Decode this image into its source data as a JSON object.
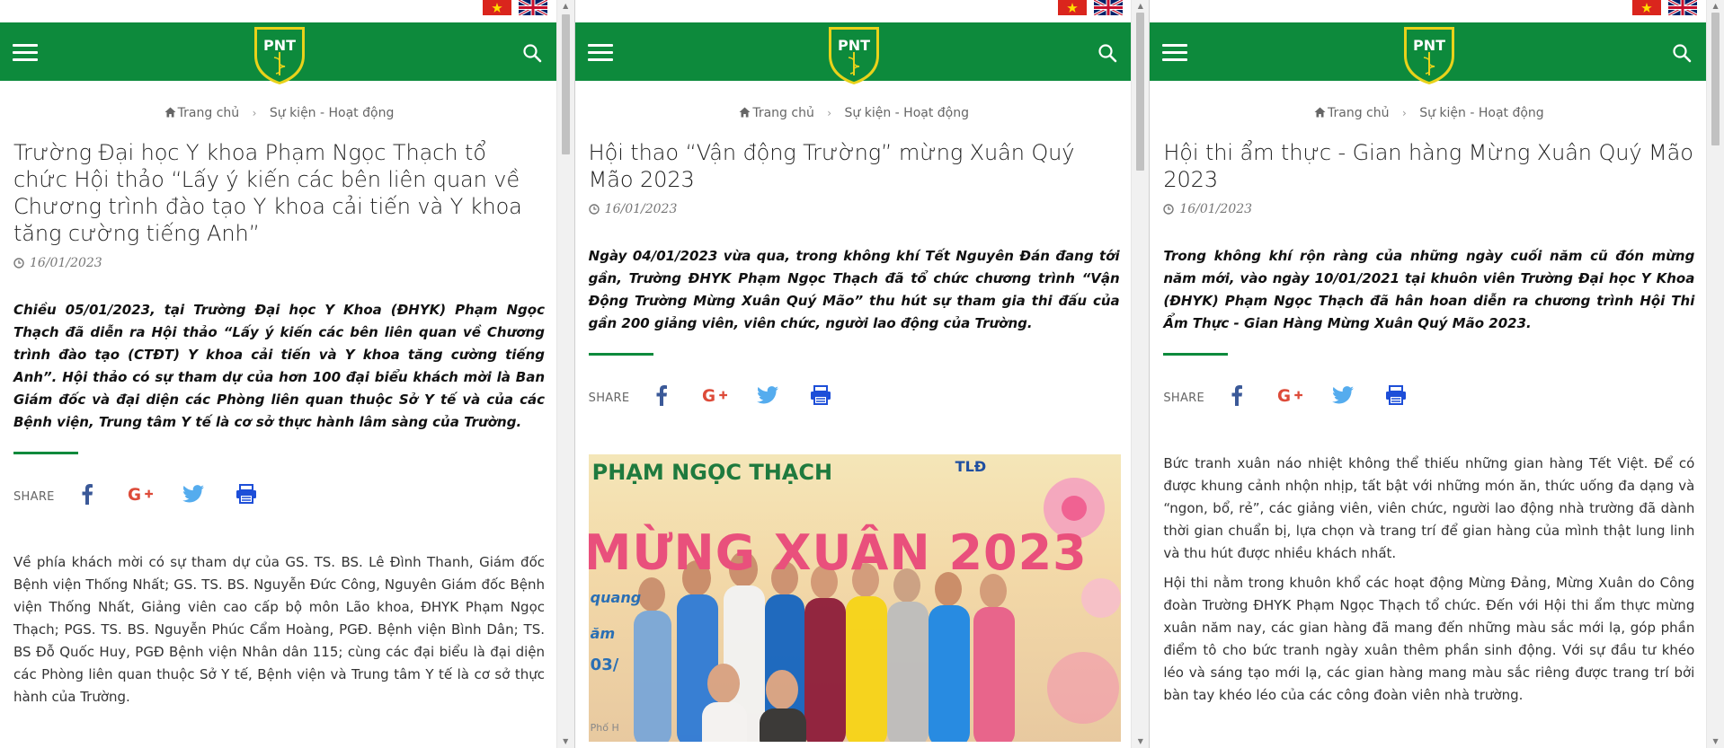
{
  "colors": {
    "brand_green": "#0d8a3c",
    "facebook": "#3b5998",
    "google_plus": "#dd4b39",
    "twitter": "#55acee",
    "print": "#1d4ed8"
  },
  "common": {
    "logo_text": "PNT",
    "breadcrumb_home": "Trang chủ",
    "breadcrumb_section": "Sự kiện - Hoạt động",
    "share_label": "SHARE",
    "icons": [
      "menu-icon",
      "search-icon",
      "vietnam-flag-icon",
      "uk-flag-icon",
      "home-icon",
      "clock-icon",
      "facebook-icon",
      "google-plus-icon",
      "twitter-icon",
      "print-icon"
    ]
  },
  "panes": [
    {
      "title": "Trường Đại học Y khoa Phạm Ngọc Thạch tổ chức Hội thảo “Lấy ý kiến các bên liên quan về Chương trình đào tạo Y khoa cải tiến và Y khoa tăng cường tiếng Anh”",
      "date": "16/01/2023",
      "lead": "Chiều 05/01/2023, tại Trường Đại học Y Khoa (ĐHYK) Phạm Ngọc Thạch đã diễn ra Hội thảo “Lấy ý kiến các bên liên quan về Chương trình đào tạo (CTĐT) Y khoa cải tiến và Y khoa tăng cường tiếng Anh”. Hội thảo có sự tham dự của hơn 100 đại biểu khách mời là Ban Giám đốc và đại diện các Phòng liên quan thuộc Sở Y tế và của các Bệnh viện, Trung tâm Y tế là cơ sở thực hành lâm sàng của Trường.",
      "body": [
        "Về phía khách mời có sự tham dự của GS. TS. BS. Lê Đình Thanh, Giám đốc Bệnh viện Thống Nhất; GS. TS. BS. Nguyễn Đức Công, Nguyên Giám đốc Bệnh viện Thống Nhất, Giảng viên cao cấp bộ môn Lão khoa, ĐHYK Phạm Ngọc Thạch; PGS. TS. BS. Nguyễn Phúc Cẩm Hoàng, PGĐ. Bệnh viện Bình Dân; TS. BS Đỗ Quốc Huy, PGĐ Bệnh viện Nhân dân 115; cùng các đại biểu là đại diện các Phòng liên quan thuộc Sở Y tế, Bệnh viện và Trung tâm Y tế là cơ sở thực hành của Trường."
      ]
    },
    {
      "title": "Hội thao “Vận động Trường” mừng Xuân Quý Mão 2023",
      "date": "16/01/2023",
      "lead": "Ngày 04/01/2023 vừa qua, trong không khí Tết Nguyên Đán đang tới gần, Trường ĐHYK Phạm Ngọc Thạch đã tổ chức chương trình “Vận Động Trường Mừng Xuân Quý Mão” thu hút sự tham gia thi đấu của gần 200 giảng viên, viên chức, người lao động của Trường.",
      "photo": {
        "banner": "PHẠM NGỌC THẠCH",
        "headline": "MỪNG XUÂN 2023",
        "badge": "TLĐ",
        "line1": "quang",
        "line2": "ăm",
        "line3": "03/",
        "line4": "Phố H"
      }
    },
    {
      "title": "Hội thi ẩm thực - Gian hàng Mừng Xuân Quý Mão 2023",
      "date": "16/01/2023",
      "lead": "Trong không khí rộn ràng của những ngày cuối năm cũ đón mừng năm mới, vào ngày 10/01/2021 tại khuôn viên Trường Đại học Y Khoa (ĐHYK) Phạm Ngọc Thạch đã hân hoan diễn ra chương trình Hội Thi Ẩm Thực - Gian Hàng Mừng Xuân Quý Mão 2023.",
      "body": [
        "Bức tranh xuân náo nhiệt không thể thiếu những gian hàng Tết Việt. Để có được khung cảnh nhộn nhịp, tất bật với những món ăn, thức uống đa dạng và “ngon, bổ, rẻ”, các giảng viên, viên chức, người lao động nhà trường đã dành thời gian chuẩn bị, lựa chọn và trang trí để gian hàng của mình thật lung linh và thu hút được nhiều khách nhất.",
        "Hội thi nằm trong khuôn khổ các hoạt động Mừng Đảng, Mừng Xuân do Công đoàn Trường ĐHYK Phạm Ngọc Thạch tổ chức. Đến với Hội thi ẩm thực mừng xuân năm nay, các gian hàng đã mang đến những màu sắc mới lạ, góp phần điểm tô cho bức tranh ngày xuân thêm phần sinh động. Với sự đầu tư khéo léo và sáng tạo mới lạ, các gian hàng mang màu sắc riêng được trang trí bởi bàn tay khéo léo của các công đoàn viên nhà trường."
      ]
    }
  ]
}
